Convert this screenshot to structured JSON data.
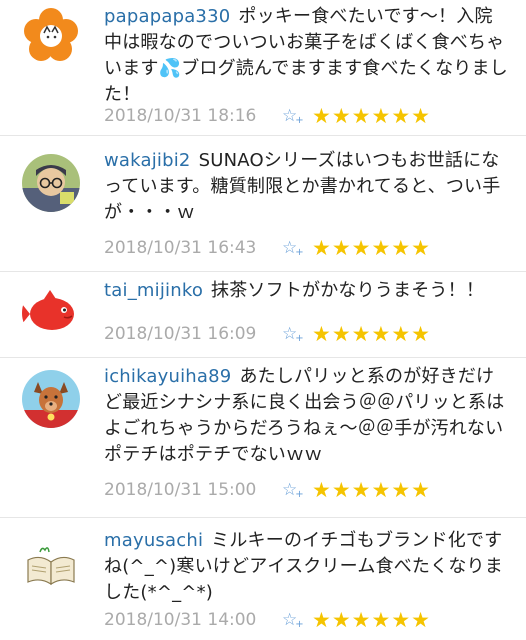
{
  "comments": [
    {
      "username": "papapapa330",
      "text": "ポッキー食べたいです～！入院中は暇なのでついついお菓子をばくばく食べちゃいます💦ブログ読んでますます食べたくなりました！",
      "timestamp": "2018/10/31 18:16",
      "stars": 6,
      "avatar_icon": "orange-flower-cat-avatar"
    },
    {
      "username": "wakajibi2",
      "text": "SUNAOシリーズはいつもお世話になっています。糖質制限とか書かれてると、つい手が・・・ｗ",
      "timestamp": "2018/10/31 16:43",
      "stars": 6,
      "avatar_icon": "glasses-man-avatar"
    },
    {
      "username": "tai_mijinko",
      "text": "抹茶ソフトがかなりうまそう！！",
      "timestamp": "2018/10/31 16:09",
      "stars": 6,
      "avatar_icon": "red-fish-avatar"
    },
    {
      "username": "ichikayuiha89",
      "text": "あたしパリッと系のが好きだけど最近シナシナ系に良く出会う＠＠パリッと系はよごれちゃうからだろうねぇ～＠＠手が汚れないポテチはポテチでないｗｗ",
      "timestamp": "2018/10/31 15:00",
      "stars": 6,
      "avatar_icon": "dog-character-avatar"
    },
    {
      "username": "mayusachi",
      "text": "ミルキーのイチゴもブランド化ですね(^_^)寒いけどアイスクリーム食べたくなりました(*^_^*)",
      "timestamp": "2018/10/31 14:00",
      "stars": 6,
      "avatar_icon": "open-book-avatar"
    }
  ],
  "add_star_icon": "add-star-icon",
  "colors": {
    "username": "#2a6fa8",
    "star": "#f5c400",
    "timestamp": "#aaaaaa"
  }
}
